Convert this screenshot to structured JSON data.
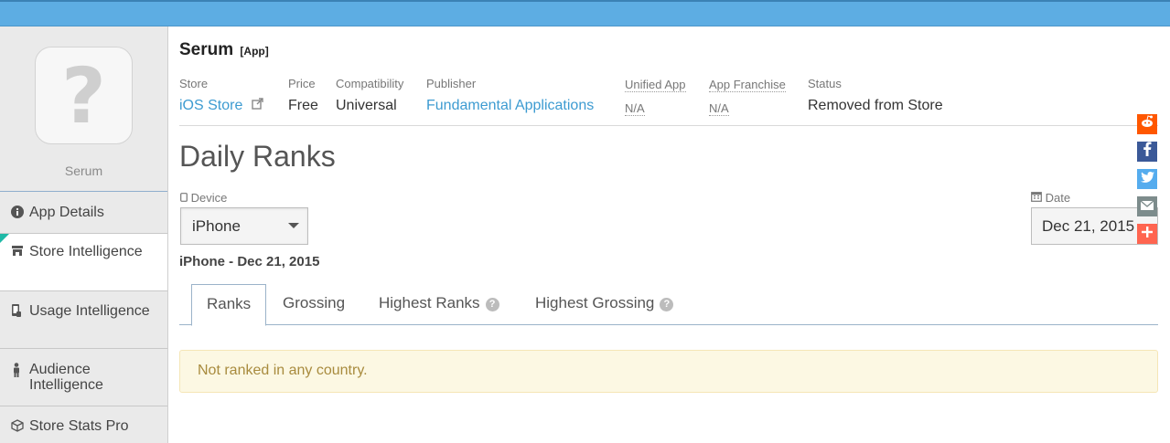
{
  "app": {
    "name": "Serum",
    "type_tag": "[App]",
    "placeholder_glyph": "?"
  },
  "sidebar": {
    "items": [
      {
        "label": "App Details",
        "icon": "info-circle-icon"
      },
      {
        "label": "Store Intelligence",
        "icon": "store-icon"
      },
      {
        "label": "Usage Intelligence",
        "icon": "usage-phone-icon"
      },
      {
        "label": "Audience Intelligence",
        "icon": "person-icon"
      },
      {
        "label": "Store Stats Pro",
        "icon": "cube-icon"
      }
    ]
  },
  "meta": {
    "store": {
      "label": "Store",
      "value": "iOS Store"
    },
    "price": {
      "label": "Price",
      "value": "Free"
    },
    "compatibility": {
      "label": "Compatibility",
      "value": "Universal"
    },
    "publisher": {
      "label": "Publisher",
      "value": "Fundamental Applications"
    },
    "unified_app": {
      "label": "Unified App",
      "value": "N/A"
    },
    "app_franchise": {
      "label": "App Franchise",
      "value": "N/A"
    },
    "status": {
      "label": "Status",
      "value": "Removed from Store"
    }
  },
  "daily_ranks": {
    "title": "Daily Ranks",
    "device_label": "Device",
    "device_value": "iPhone",
    "date_label": "Date",
    "date_value": "Dec 21, 2015",
    "subheading": "iPhone - Dec 21, 2015",
    "tabs": [
      "Ranks",
      "Grossing",
      "Highest Ranks",
      "Highest Grossing"
    ],
    "active_tab": "Ranks",
    "notice": "Not ranked in any country."
  },
  "colors": {
    "topbar": "#5dade3",
    "link": "#3d9bd1",
    "notice_bg": "#fcf8e3",
    "accent_teal": "#1fb9a6"
  },
  "share_buttons": [
    {
      "name": "reddit",
      "color": "#ff5700"
    },
    {
      "name": "facebook",
      "color": "#3b5998"
    },
    {
      "name": "twitter",
      "color": "#55acee"
    },
    {
      "name": "email",
      "color": "#7d8c8c"
    },
    {
      "name": "more",
      "color": "#ff6550"
    }
  ]
}
